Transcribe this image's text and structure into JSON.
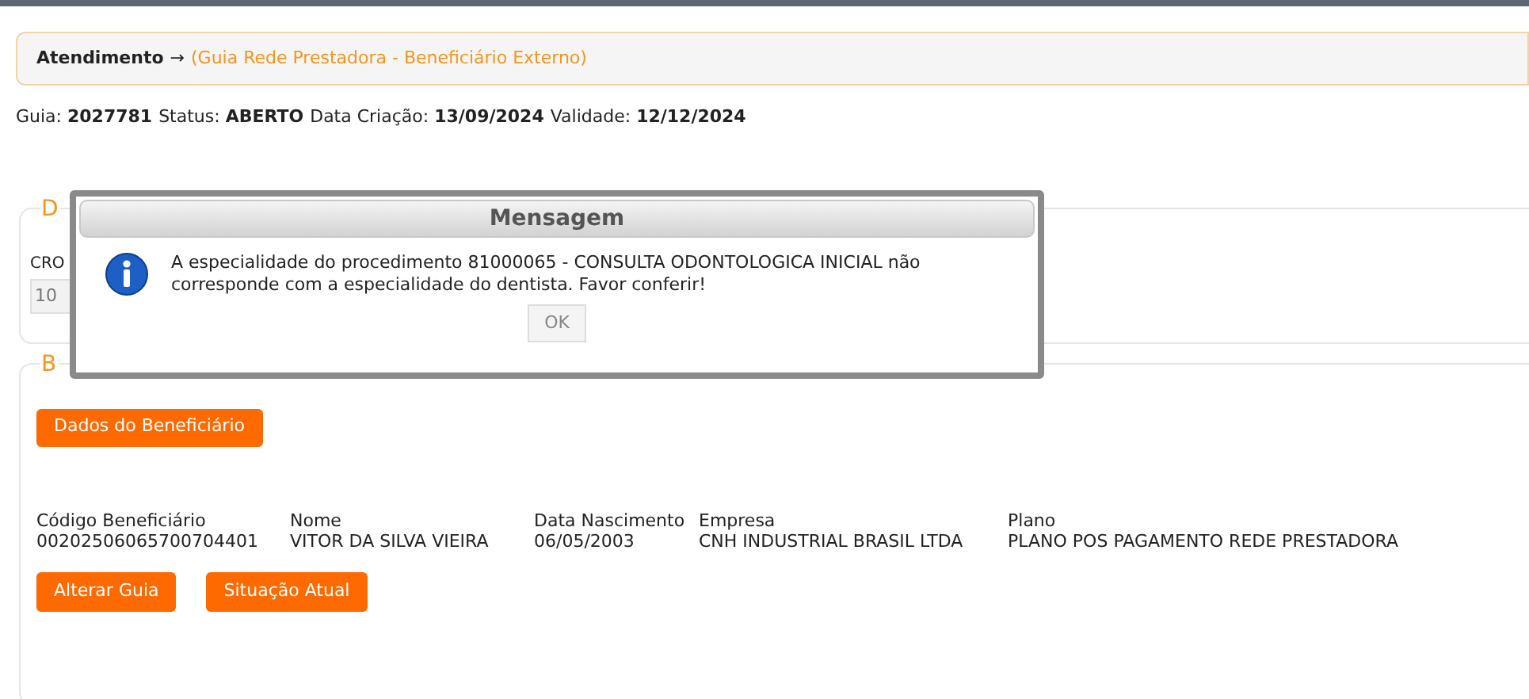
{
  "breadcrumb": {
    "section": "Atendimento",
    "arrow": "→",
    "page": "(Guia Rede Prestadora - Beneficiário Externo)"
  },
  "guide_info": [
    {
      "label": "Guia:",
      "value": "2027781"
    },
    {
      "label": "Status:",
      "value": "ABERTO"
    },
    {
      "label": "Data Criação:",
      "value": "13/09/2024"
    },
    {
      "label": "Validade:",
      "value": "12/12/2024"
    }
  ],
  "dentist_section": {
    "legend": "D",
    "field_label": "CRO",
    "field_value": "10"
  },
  "beneficiary_section": {
    "legend": "B",
    "data_button": "Dados do Beneficiário",
    "fields": [
      {
        "label": "Código Beneficiário",
        "value": "00202506065700704401"
      },
      {
        "label": "Nome",
        "value": "VITOR DA SILVA VIEIRA"
      },
      {
        "label": "Data Nascimento",
        "value": "06/05/2003"
      },
      {
        "label": "Empresa",
        "value": "CNH INDUSTRIAL BRASIL LTDA"
      },
      {
        "label": "Plano",
        "value": "PLANO POS PAGAMENTO REDE PRESTADORA"
      }
    ],
    "actions": [
      "Alterar Guia",
      "Situação Atual"
    ]
  },
  "dialog": {
    "title": "Mensagem",
    "message": "A especialidade do procedimento 81000065 - CONSULTA ODONTOLOGICA INICIAL não corresponde com a especialidade do dentista. Favor conferir!",
    "button": "OK"
  }
}
